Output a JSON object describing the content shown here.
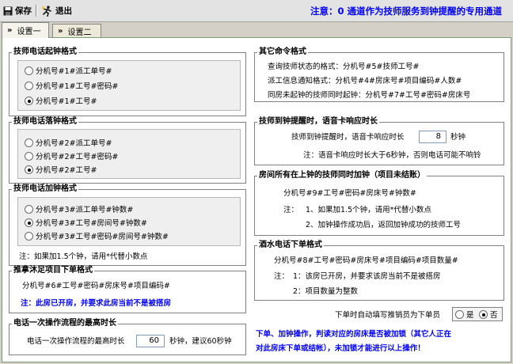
{
  "toolbar": {
    "save_label": "保存",
    "exit_label": "退出"
  },
  "notice": "注意：0 通道作为技师服务到钟提醒的专用通道",
  "tabs": [
    {
      "label": "设置一"
    },
    {
      "label": "设置二"
    }
  ],
  "start_clock": {
    "title": "技师电话起钟格式",
    "options": [
      "分机号#1#派工单号#",
      "分机号#1#工号#密码#",
      "分机号#1#工号#"
    ],
    "selected_index": 2
  },
  "end_clock": {
    "title": "技师电话落钟格式",
    "options": [
      "分机号#2#派工单号#",
      "分机号#2#工号#密码#",
      "分机号#2#工号#"
    ],
    "selected_index": 2
  },
  "add_clock": {
    "title": "技师电话加钟格式",
    "options": [
      "分机号#3#派工单号#钟数#",
      "分机号#3#工号#房间号#钟数#",
      "分机号#3#工号#密码#房间号#钟数#"
    ],
    "selected_index": 1,
    "note": "注：如果加1.5个钟，请用*代替小数点"
  },
  "foot_project": {
    "title": "推拿沐足项目下单格式",
    "format": "分机号#6#工号#密码#房床号#项目编码#",
    "warning": "注：此房已开房，并要求此房当前不是被搭房"
  },
  "one_call": {
    "title": "电话一次操作流程的最高时长",
    "label": "电话一次操作流程的最高时长",
    "value": "60",
    "suffix": "秒钟，建议60秒钟"
  },
  "other_cmd": {
    "title": "其它命令格式",
    "lines": [
      "查询技师状态的格式：分机号#5#技师工号#",
      "派工信息通知格式：分机号#4#房床号#项目编码#人数#",
      "同房未起钟的技师同时起钟：分机号#7#工号#密码#房床号"
    ]
  },
  "reminder": {
    "title": "技师到钟提醒时，语音卡响应时长",
    "label": "技师到钟提醒时，语音卡响应时长",
    "value": "8",
    "unit": "秒钟",
    "note": "注：语音卡响应时长大于6秒钟，否则电话可能不响铃"
  },
  "room_add": {
    "title": "房间所有在上钟的技师同时加钟（项目未结账）",
    "format": "分机号#9#工号#密码#房床号#钟数#",
    "note_prefix": "注：",
    "note1": "1、如果加1.5个钟，请用*代替小数点",
    "note2": "2、加钟操作成功后，返回加钟成功的技师工号"
  },
  "drink_order": {
    "title": "酒水电话下单格式",
    "format": "分机号#8#工号#密码#房床号#项目编码#项目数量#",
    "note_prefix": "注：",
    "note1": "1：该房已开房，并要求该房当前不是被搭房",
    "note2": "2：项目数量为整数"
  },
  "auto_fill": {
    "label": "下单时自动填写推销员为下单员",
    "options": [
      "是",
      "否"
    ],
    "selected_index": 1
  },
  "bottom_note_1": "下单、加钟操作，判读对应的房床是否被加锁（其它人正在",
  "bottom_note_2": "对此房床下单或结帐），未加锁才能进行以上操作！"
}
